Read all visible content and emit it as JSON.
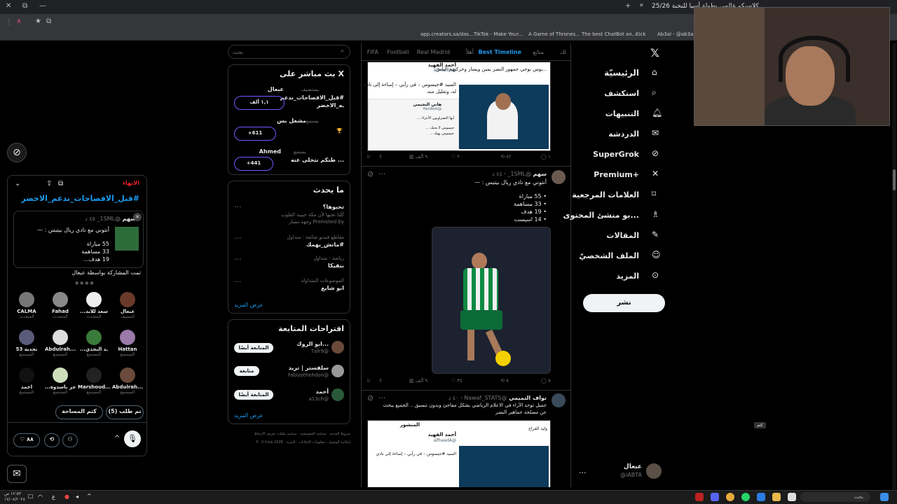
{
  "browser": {
    "tab_title": "كلاسيكو عالمي بطولة أسيا للنخبة 25/26",
    "new_tab": "+",
    "bookmarks": [
      "app.creators.sa/das...",
      "TikTok - Make Your...",
      "A Game of Thrones...",
      "The best ChatBot an...",
      "Kick",
      "Ab3al - @ab3al | C..."
    ]
  },
  "sidebar_nav": {
    "items": [
      "الرئيسيّة",
      "استكشف",
      "التنبيهات",
      "الدردشة",
      "SuperGrok",
      "+Premium",
      "العلامات المرجعية",
      "...بو منشئ المحتوى",
      "المقالات",
      "الملف الشخصيّ",
      "المزيد"
    ],
    "post_label": "نشر",
    "account_name": "عبعال",
    "account_handle": "@iABTA",
    "more": "..."
  },
  "timeline": {
    "tabs": [
      "لك",
      "متابَع",
      "Best Timeline",
      "أهلاً",
      "Real Madrid",
      "Football",
      "FIFA"
    ],
    "tweet1": {
      "quote_name": "أحمد الفهيد",
      "quote_handle": "@alfheedA",
      "text1": "...يوس بوجي جمهور النصر يمين ويسار وحركيهم الياس",
      "text2": "السيد #جيسوس – في رأيي – إساءة إلى نادي",
      "text3": "له، وتقليل منه.",
      "inner_name": "هاني النجيمي",
      "inner_handle": "@HaniNoh",
      "inner_lines": [
        "أيها النصراويون الأعزاء ...",
        "جيسوس لا يحبك ...",
        "جيسوس يهيك ..."
      ],
      "actions": [
        "١",
        "٢٠",
        "٩ ألف",
        "٤٢"
      ]
    },
    "tweet2": {
      "name": "سهم",
      "handle": "@1SML_",
      "time": "٤٤ د",
      "text": "أنتوني مع نادي ريال بيتيس : —",
      "stats": [
        "55 مباراة",
        "33 مساهمة",
        "19 هدف",
        "14 اسيست"
      ],
      "actions": [
        "٧",
        "٧",
        "٣٤",
        "٩ ألف"
      ]
    },
    "tweet3": {
      "name": "نواف التميمي",
      "handle": "@Nawaf_STATS",
      "time": "٤٠ د",
      "text1": "جميل توحد الآراء في الاعلام الرياضي بشكل مفاجئ وبدون تنسيق .. الجميع يبحث",
      "text2": "عن مصلحة جماهير النصر",
      "card_title": "المنشور",
      "card_user": "وليد الفراج",
      "quote_name": "أحمد الفهيد",
      "quote_handle": "@alfheedA"
    }
  },
  "search": {
    "placeholder": "بحث"
  },
  "live_widget": {
    "title": "X بث مباشر على",
    "items": [
      {
        "host": "عبعال",
        "label": "يستضيف",
        "title": "#قبل_الافصاحات_ندعم",
        "title2": "ـه_الاخضر",
        "count": "١,١ ألف"
      },
      {
        "host": "مشعل بس",
        "label": "يستمع",
        "title": "",
        "count": "+611"
      },
      {
        "host": "Ahmed",
        "label": "يستمع",
        "title": "... طنكم نتخلى عنه",
        "count": "+441"
      }
    ]
  },
  "trends": {
    "title": "ما يحدث",
    "items": [
      {
        "meta": "",
        "name": "تحبوها؟",
        "desc": "كُلنا نحبها لأن مكة حبيبة القلوب",
        "promo": "Promoted by وجهة مسار"
      },
      {
        "meta": "مقاطع فيديو شائعة · متداول",
        "name": "#ماتش_يهمك"
      },
      {
        "meta": "رياضة · متداول",
        "name": "بنفيكا"
      },
      {
        "meta": "الموضوعات المتداولة",
        "name": "ابو شايع"
      }
    ],
    "more": "عرض المزيد"
  },
  "suggestions": {
    "title": "اقتراحات المتابعة",
    "items": [
      {
        "name": "...ابو الروك",
        "handle": "@7afr9",
        "button": "المتابعة أيضًا"
      },
      {
        "name": "سلفستر | تريد",
        "handle": "@Fabizothehdon",
        "button": "متابعة"
      },
      {
        "name": "أحمد",
        "handle": "@a13ch",
        "button": "المتابعة أيضًا"
      }
    ],
    "more": "عرض المزيد"
  },
  "footer_links": [
    "شروط الخدمة",
    "سياسة الخصوصية",
    "سياسة ملفات تعريف الارتباط",
    "إمكانية الوصول",
    "معلومات الإعلانات",
    "المزيد",
    "2026 X Corp. ©"
  ],
  "space_panel": {
    "leave": "الانهاء",
    "title": "#قبل_الافصاحات_ندعم_الاخضر",
    "pinned_name": "سهم",
    "pinned_handle": "@1SML_",
    "pinned_time": "٤٥ د",
    "pinned_text": "أنتوني مع نادي ريال بيتيس : —",
    "pinned_stats": [
      "55 مباراة",
      "33 مساهمة",
      "19 هدف..."
    ],
    "shared_by": "تمت المشاركة بواسطة عبعال",
    "speakers": [
      {
        "name": "عبعال",
        "role": "المضيف"
      },
      {
        "name": "...سعد للابد",
        "role": "المتحدث"
      },
      {
        "name": "Fahad",
        "role": "المتحدث"
      },
      {
        "name": "CALMA",
        "role": "المتحدث"
      },
      {
        "name": "Hattan",
        "role": "المستمع"
      },
      {
        "name": "...ـد النجدي",
        "role": "المستمع"
      },
      {
        "name": "Abdulrah...",
        "role": "المستمع"
      },
      {
        "name": "53 نجدية",
        "role": "المستمع"
      },
      {
        "name": "Abdulrah...",
        "role": "المستمع"
      },
      {
        "name": "Marshoud...",
        "role": "المستمع"
      },
      {
        "name": "...جر باسدوة",
        "role": "المستمع"
      },
      {
        "name": "احمد",
        "role": "المستمع"
      }
    ],
    "request_btn": "تم طلب (5)",
    "mute_btn": "كتم المساحة",
    "like_count": "٨٨"
  },
  "taskbar": {
    "time": "١٢:٥٣ ص",
    "date": "١٧/٠٨/٢٠٢٨",
    "search": "بحث",
    "lang": "ع"
  },
  "tooltip": "كتم"
}
